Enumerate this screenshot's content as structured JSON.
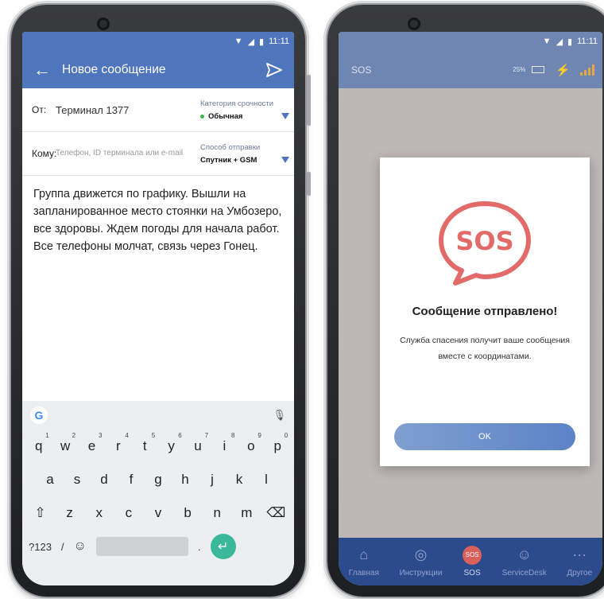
{
  "left_phone": {
    "status": {
      "time": "11:11"
    },
    "header": {
      "title": "Новое сообщение"
    },
    "from": {
      "label": "От:",
      "value": "Терминал 1377",
      "urgency_label": "Категория срочности",
      "urgency_value": "Обычная"
    },
    "to": {
      "label": "Кому:",
      "placeholder": "Телефон, ID терминала или e-mail",
      "method_label": "Способ отправки",
      "method_value": "Спутник + GSM"
    },
    "message": "Группа движется по графику. Вышли на запланированное место стоянки на Умбозеро, все здоровы. Ждем погоды для начала работ. Все телефоны молчат, связь через Гонец.",
    "keyboard": {
      "row1": [
        {
          "k": "q",
          "n": "1"
        },
        {
          "k": "w",
          "n": "2"
        },
        {
          "k": "e",
          "n": "3"
        },
        {
          "k": "r",
          "n": "4"
        },
        {
          "k": "t",
          "n": "5"
        },
        {
          "k": "y",
          "n": "6"
        },
        {
          "k": "u",
          "n": "7"
        },
        {
          "k": "i",
          "n": "8"
        },
        {
          "k": "o",
          "n": "9"
        },
        {
          "k": "p",
          "n": "0"
        }
      ],
      "row2": [
        "a",
        "s",
        "d",
        "f",
        "g",
        "h",
        "j",
        "k",
        "l"
      ],
      "row3": [
        "z",
        "x",
        "c",
        "v",
        "b",
        "n",
        "m"
      ],
      "symbols_key": "?123",
      "slash_key": "/",
      "period_key": "."
    }
  },
  "right_phone": {
    "status": {
      "time": "11:11"
    },
    "header": {
      "title": "SOS",
      "battery": "25%"
    },
    "dialog": {
      "icon_text": "SOS",
      "title": "Сообщение отправлено!",
      "text": "Служба спасения получит ваше сообщения вместе с координатами.",
      "ok_label": "OK"
    },
    "tabs": [
      "Главная",
      "Инструкции",
      "SOS",
      "ServiceDesk",
      "Другое"
    ]
  }
}
